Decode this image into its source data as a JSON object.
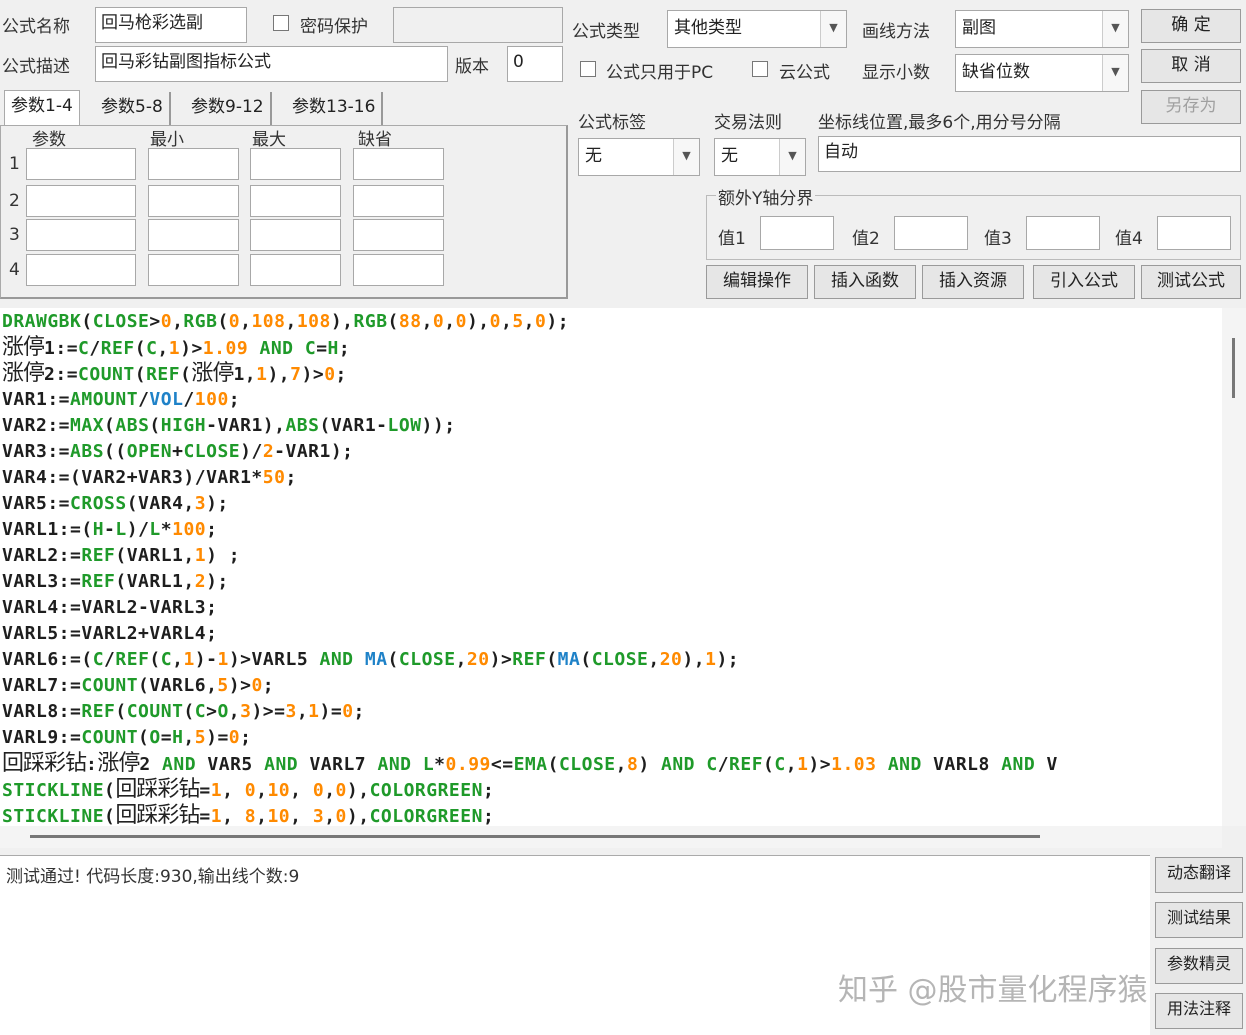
{
  "header": {
    "name_label": "公式名称",
    "name_value": "回马枪彩选副",
    "password_label": "密码保护",
    "desc_label": "公式描述",
    "desc_value": "回马彩钻副图指标公式",
    "version_label": "版本",
    "version_value": "0",
    "type_label": "公式类型",
    "type_value": "其他类型",
    "draw_label": "画线方法",
    "draw_value": "副图",
    "pc_only_label": "公式只用于PC",
    "cloud_label": "云公式",
    "decimal_label": "显示小数",
    "decimal_value": "缺省位数",
    "ok": "确  定",
    "cancel": "取  消",
    "save_as": "另存为"
  },
  "params": {
    "tabs": [
      "参数1-4",
      "参数5-8",
      "参数9-12",
      "参数13-16"
    ],
    "columns": [
      "参数",
      "最小",
      "最大",
      "缺省"
    ],
    "rows": [
      "1",
      "2",
      "3",
      "4"
    ]
  },
  "tags": {
    "tag_label": "公式标签",
    "tag_value": "无",
    "rule_label": "交易法则",
    "rule_value": "无",
    "axis_label": "坐标线位置,最多6个,用分号分隔",
    "axis_value": "自动",
    "y_group": "额外Y轴分界",
    "values": [
      "值1",
      "值2",
      "值3",
      "值4"
    ]
  },
  "actions": [
    "编辑操作",
    "插入函数",
    "插入资源",
    "引入公式",
    "测试公式"
  ],
  "colors": {
    "G": "#1f9a2a",
    "O": "#ff8a00",
    "B": "#1f82c8",
    "K": "#1e1e1e"
  },
  "code": [
    [
      [
        "DRAWGBK",
        "G"
      ],
      [
        "(",
        "K"
      ],
      [
        "CLOSE",
        "G"
      ],
      [
        ">",
        "K"
      ],
      [
        "0",
        "O"
      ],
      [
        ",",
        "K"
      ],
      [
        "RGB",
        "G"
      ],
      [
        "(",
        "K"
      ],
      [
        "0",
        "O"
      ],
      [
        ",",
        "K"
      ],
      [
        "108",
        "O"
      ],
      [
        ",",
        "K"
      ],
      [
        "108",
        "O"
      ],
      [
        "),",
        "K"
      ],
      [
        "RGB",
        "G"
      ],
      [
        "(",
        "K"
      ],
      [
        "88",
        "O"
      ],
      [
        ",",
        "K"
      ],
      [
        "0",
        "O"
      ],
      [
        ",",
        "K"
      ],
      [
        "0",
        "O"
      ],
      [
        "),",
        "K"
      ],
      [
        "0",
        "O"
      ],
      [
        ",",
        "K"
      ],
      [
        "5",
        "O"
      ],
      [
        ",",
        "K"
      ],
      [
        "0",
        "O"
      ],
      [
        ");",
        "K"
      ]
    ],
    [
      [
        "涨停",
        "C"
      ],
      [
        "1:=",
        "K"
      ],
      [
        "C",
        "G"
      ],
      [
        "/",
        "K"
      ],
      [
        "REF",
        "G"
      ],
      [
        "(",
        "K"
      ],
      [
        "C",
        "G"
      ],
      [
        ",",
        "K"
      ],
      [
        "1",
        "O"
      ],
      [
        ")>",
        "K"
      ],
      [
        "1.",
        "O"
      ],
      [
        "09",
        "O"
      ],
      [
        " AND ",
        "G"
      ],
      [
        "C",
        "G"
      ],
      [
        "=",
        "K"
      ],
      [
        "H",
        "G"
      ],
      [
        ";",
        "K"
      ]
    ],
    [
      [
        "涨停",
        "C"
      ],
      [
        "2:=",
        "K"
      ],
      [
        "COUNT",
        "G"
      ],
      [
        "(",
        "K"
      ],
      [
        "REF",
        "G"
      ],
      [
        "(",
        "K"
      ],
      [
        "涨停",
        "C"
      ],
      [
        "1,",
        "K"
      ],
      [
        "1",
        "O"
      ],
      [
        "),",
        "K"
      ],
      [
        "7",
        "O"
      ],
      [
        ")>",
        "K"
      ],
      [
        "0",
        "O"
      ],
      [
        ";",
        "K"
      ]
    ],
    [
      [
        "VAR1:=",
        "K"
      ],
      [
        "AMOUNT",
        "G"
      ],
      [
        "/",
        "K"
      ],
      [
        "VOL",
        "B"
      ],
      [
        "/",
        "K"
      ],
      [
        "100",
        "O"
      ],
      [
        ";",
        "K"
      ]
    ],
    [
      [
        "VAR2:=",
        "K"
      ],
      [
        "MAX",
        "G"
      ],
      [
        "(",
        "K"
      ],
      [
        "ABS",
        "G"
      ],
      [
        "(",
        "K"
      ],
      [
        "HIGH",
        "G"
      ],
      [
        "-VAR1),",
        "K"
      ],
      [
        "ABS",
        "G"
      ],
      [
        "(VAR1-",
        "K"
      ],
      [
        "LOW",
        "G"
      ],
      [
        "));",
        "K"
      ]
    ],
    [
      [
        "VAR3:=",
        "K"
      ],
      [
        "ABS",
        "G"
      ],
      [
        "((",
        "K"
      ],
      [
        "OPEN",
        "G"
      ],
      [
        "+",
        "K"
      ],
      [
        "CLOSE",
        "G"
      ],
      [
        ")/",
        "K"
      ],
      [
        "2",
        "O"
      ],
      [
        "-VAR1);",
        "K"
      ]
    ],
    [
      [
        "VAR4:=(VAR2+VAR3)/VAR1*",
        "K"
      ],
      [
        "50",
        "O"
      ],
      [
        ";",
        "K"
      ]
    ],
    [
      [
        "VAR5:=",
        "K"
      ],
      [
        "CROSS",
        "G"
      ],
      [
        "(VAR4,",
        "K"
      ],
      [
        "3",
        "O"
      ],
      [
        ");",
        "K"
      ]
    ],
    [
      [
        "VARL1:=(",
        "K"
      ],
      [
        "H",
        "G"
      ],
      [
        "-",
        "K"
      ],
      [
        "L",
        "G"
      ],
      [
        ")/",
        "K"
      ],
      [
        "L",
        "G"
      ],
      [
        "*",
        "K"
      ],
      [
        "100",
        "O"
      ],
      [
        ";",
        "K"
      ]
    ],
    [
      [
        "VARL2:=",
        "K"
      ],
      [
        "REF",
        "G"
      ],
      [
        "(VARL1,",
        "K"
      ],
      [
        "1",
        "O"
      ],
      [
        ") ;",
        "K"
      ]
    ],
    [
      [
        "VARL3:=",
        "K"
      ],
      [
        "REF",
        "G"
      ],
      [
        "(VARL1,",
        "K"
      ],
      [
        "2",
        "O"
      ],
      [
        ");",
        "K"
      ]
    ],
    [
      [
        "VARL4:=VARL2-VARL3;",
        "K"
      ]
    ],
    [
      [
        "VARL5:=VARL2+VARL4;",
        "K"
      ]
    ],
    [
      [
        "VARL6:=(",
        "K"
      ],
      [
        "C",
        "G"
      ],
      [
        "/",
        "K"
      ],
      [
        "REF",
        "G"
      ],
      [
        "(",
        "K"
      ],
      [
        "C",
        "G"
      ],
      [
        ",",
        "K"
      ],
      [
        "1",
        "O"
      ],
      [
        ")-",
        "K"
      ],
      [
        "1",
        "O"
      ],
      [
        ")>VARL5",
        "K"
      ],
      [
        " AND ",
        "G"
      ],
      [
        "MA",
        "B"
      ],
      [
        "(",
        "K"
      ],
      [
        "CLOSE",
        "G"
      ],
      [
        ",",
        "K"
      ],
      [
        "20",
        "O"
      ],
      [
        ")>",
        "K"
      ],
      [
        "REF",
        "G"
      ],
      [
        "(",
        "K"
      ],
      [
        "MA",
        "B"
      ],
      [
        "(",
        "K"
      ],
      [
        "CLOSE",
        "G"
      ],
      [
        ",",
        "K"
      ],
      [
        "20",
        "O"
      ],
      [
        "),",
        "K"
      ],
      [
        "1",
        "O"
      ],
      [
        ");",
        "K"
      ]
    ],
    [
      [
        "VARL7:=",
        "K"
      ],
      [
        "COUNT",
        "G"
      ],
      [
        "(VARL6,",
        "K"
      ],
      [
        "5",
        "O"
      ],
      [
        ")>",
        "K"
      ],
      [
        "0",
        "O"
      ],
      [
        ";",
        "K"
      ]
    ],
    [
      [
        "VARL8:=",
        "K"
      ],
      [
        "REF",
        "G"
      ],
      [
        "(",
        "K"
      ],
      [
        "COUNT",
        "G"
      ],
      [
        "(",
        "K"
      ],
      [
        "C",
        "G"
      ],
      [
        ">",
        "K"
      ],
      [
        "O",
        "G"
      ],
      [
        ",",
        "K"
      ],
      [
        "3",
        "O"
      ],
      [
        ")>=",
        "K"
      ],
      [
        "3",
        "O"
      ],
      [
        ",",
        "K"
      ],
      [
        "1",
        "O"
      ],
      [
        ")=",
        "K"
      ],
      [
        "0",
        "O"
      ],
      [
        ";",
        "K"
      ]
    ],
    [
      [
        "VARL9:=",
        "K"
      ],
      [
        "COUNT",
        "G"
      ],
      [
        "(",
        "K"
      ],
      [
        "O",
        "G"
      ],
      [
        "=",
        "K"
      ],
      [
        "H",
        "G"
      ],
      [
        ",",
        "K"
      ],
      [
        "5",
        "O"
      ],
      [
        ")=",
        "K"
      ],
      [
        "0",
        "O"
      ],
      [
        ";",
        "K"
      ]
    ],
    [
      [
        "回踩彩钻",
        "C"
      ],
      [
        ":",
        "K"
      ],
      [
        "涨停",
        "C"
      ],
      [
        "2",
        "K"
      ],
      [
        " AND ",
        "G"
      ],
      [
        "VAR5",
        "K"
      ],
      [
        " AND ",
        "G"
      ],
      [
        "VARL7",
        "K"
      ],
      [
        " AND ",
        "G"
      ],
      [
        "L",
        "G"
      ],
      [
        "*",
        "K"
      ],
      [
        "0.",
        "O"
      ],
      [
        "99",
        "O"
      ],
      [
        "<=",
        "K"
      ],
      [
        "EMA",
        "G"
      ],
      [
        "(",
        "K"
      ],
      [
        "CLOSE",
        "G"
      ],
      [
        ",",
        "K"
      ],
      [
        "8",
        "O"
      ],
      [
        ")",
        "K"
      ],
      [
        " AND ",
        "G"
      ],
      [
        "C",
        "G"
      ],
      [
        "/",
        "K"
      ],
      [
        "REF",
        "G"
      ],
      [
        "(",
        "K"
      ],
      [
        "C",
        "G"
      ],
      [
        ",",
        "K"
      ],
      [
        "1",
        "O"
      ],
      [
        ")>",
        "K"
      ],
      [
        "1.",
        "O"
      ],
      [
        "03",
        "O"
      ],
      [
        " AND ",
        "G"
      ],
      [
        "VARL8",
        "K"
      ],
      [
        " AND ",
        "G"
      ],
      [
        "V",
        "K"
      ]
    ],
    [
      [
        "STICKLINE",
        "G"
      ],
      [
        "(",
        "K"
      ],
      [
        "回踩彩钻",
        "C"
      ],
      [
        "=",
        "K"
      ],
      [
        "1",
        "O"
      ],
      [
        ", ",
        "K"
      ],
      [
        "0",
        "O"
      ],
      [
        ",",
        "K"
      ],
      [
        "10",
        "O"
      ],
      [
        ", ",
        "K"
      ],
      [
        "0",
        "O"
      ],
      [
        ",",
        "K"
      ],
      [
        "0",
        "O"
      ],
      [
        "),",
        "K"
      ],
      [
        "COLORGREEN",
        "G"
      ],
      [
        ";",
        "K"
      ]
    ],
    [
      [
        "STICKLINE",
        "G"
      ],
      [
        "(",
        "K"
      ],
      [
        "回踩彩钻",
        "C"
      ],
      [
        "=",
        "K"
      ],
      [
        "1",
        "O"
      ],
      [
        ", ",
        "K"
      ],
      [
        "8",
        "O"
      ],
      [
        ",",
        "K"
      ],
      [
        "10",
        "O"
      ],
      [
        ", ",
        "K"
      ],
      [
        "3",
        "O"
      ],
      [
        ",",
        "K"
      ],
      [
        "0",
        "O"
      ],
      [
        "),",
        "K"
      ],
      [
        "COLORGREEN",
        "G"
      ],
      [
        ";",
        "K"
      ]
    ]
  ],
  "output": {
    "message": "测试通过! 代码长度:930,输出线个数:9"
  },
  "side_buttons": [
    "动态翻译",
    "测试结果",
    "参数精灵",
    "用法注释"
  ],
  "watermark": "知乎 @股市量化程序猿"
}
